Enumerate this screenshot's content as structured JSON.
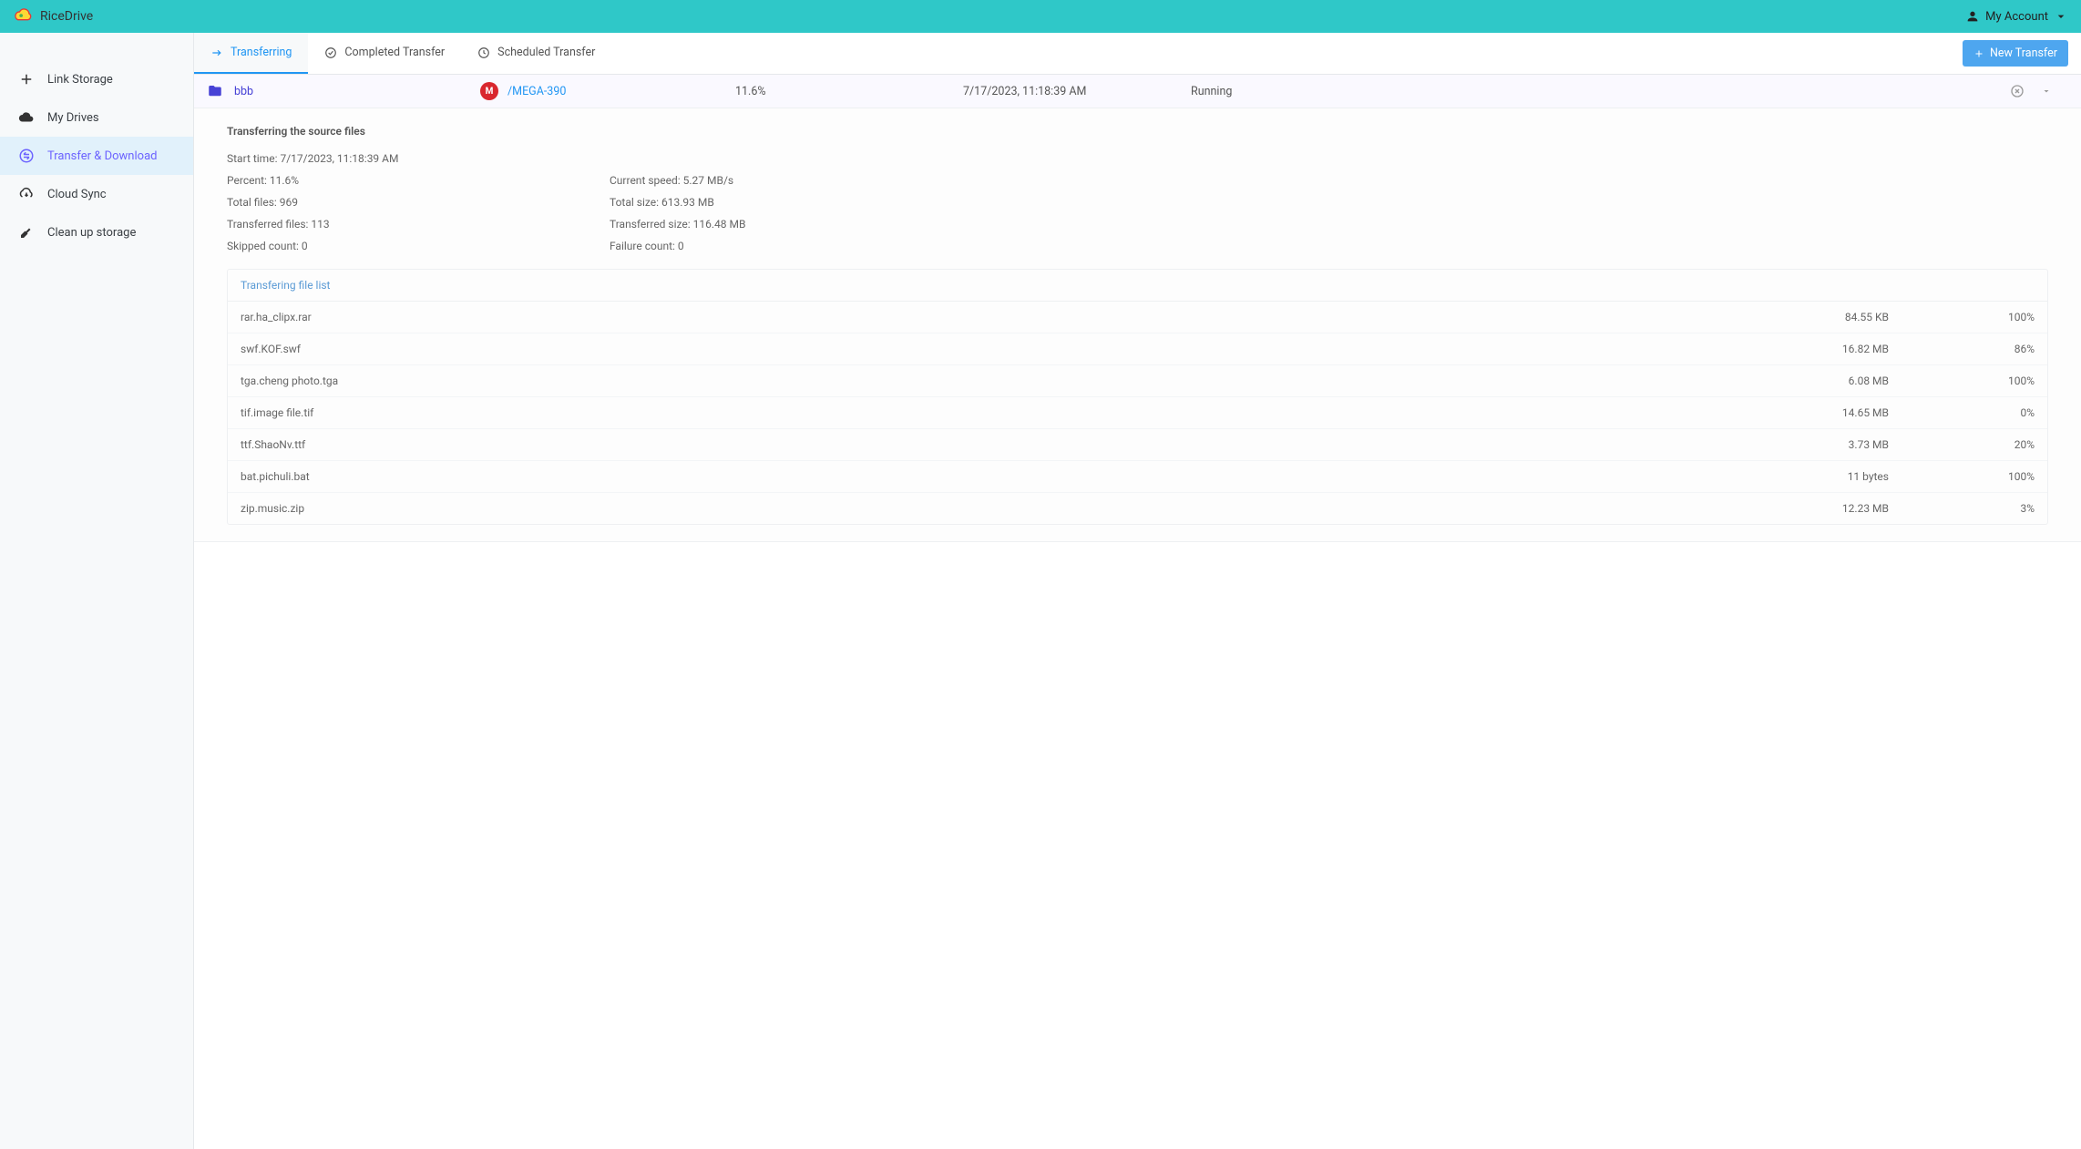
{
  "brand": {
    "title": "RiceDrive"
  },
  "account": {
    "label": "My Account"
  },
  "sidebar": {
    "items": [
      {
        "label": "Link Storage"
      },
      {
        "label": "My Drives"
      },
      {
        "label": "Transfer & Download"
      },
      {
        "label": "Cloud Sync"
      },
      {
        "label": "Clean up storage"
      }
    ]
  },
  "tabs": {
    "transferring": "Transferring",
    "completed": "Completed Transfer",
    "scheduled": "Scheduled Transfer"
  },
  "buttons": {
    "new_transfer": "New Transfer"
  },
  "transfer": {
    "source_name": "bbb",
    "dest_name": "/MEGA-390",
    "percent": "11.6%",
    "time": "7/17/2023, 11:18:39 AM",
    "status": "Running"
  },
  "details": {
    "title": "Transferring the source files",
    "start_time": "Start time: 7/17/2023, 11:18:39 AM",
    "percent": "Percent: 11.6%",
    "current_speed": "Current speed: 5.27 MB/s",
    "total_files": "Total files: 969",
    "total_size": "Total size: 613.93 MB",
    "transferred_files": "Transferred files: 113",
    "transferred_size": "Transferred size: 116.48 MB",
    "skipped_count": "Skipped count: 0",
    "failure_count": "Failure count: 0"
  },
  "file_list": {
    "header": "Transfering file list",
    "rows": [
      {
        "name": "rar.ha_clipx.rar",
        "size": "84.55 KB",
        "progress": "100%"
      },
      {
        "name": "swf.KOF.swf",
        "size": "16.82 MB",
        "progress": "86%"
      },
      {
        "name": "tga.cheng photo.tga",
        "size": "6.08 MB",
        "progress": "100%"
      },
      {
        "name": "tif.image file.tif",
        "size": "14.65 MB",
        "progress": "0%"
      },
      {
        "name": "ttf.ShaoNv.ttf",
        "size": "3.73 MB",
        "progress": "20%"
      },
      {
        "name": "bat.pichuli.bat",
        "size": "11 bytes",
        "progress": "100%"
      },
      {
        "name": "zip.music.zip",
        "size": "12.23 MB",
        "progress": "3%"
      }
    ]
  }
}
